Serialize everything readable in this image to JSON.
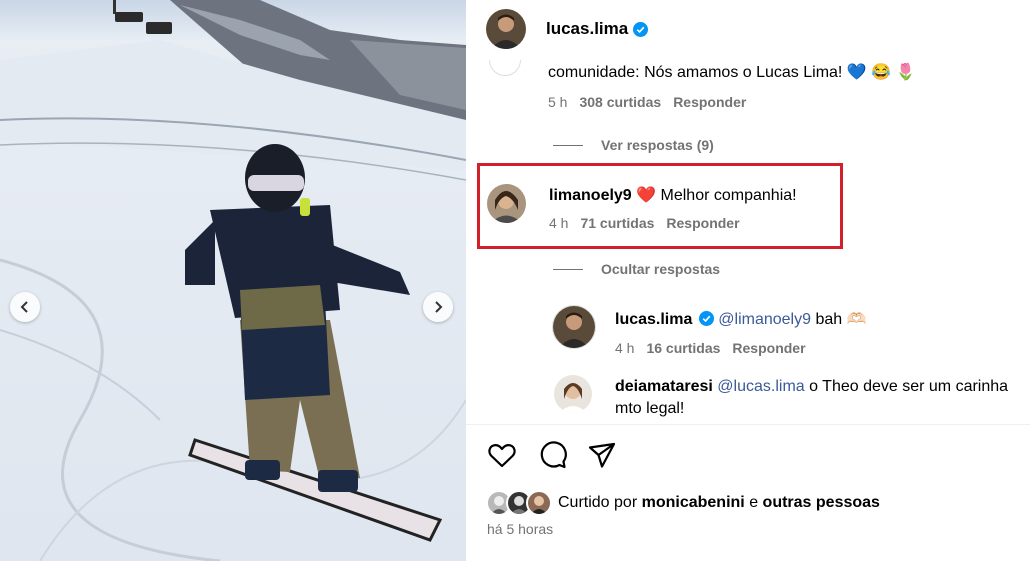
{
  "post": {
    "author": "lucas.lima"
  },
  "comments": {
    "prev_comment": {
      "text": "comunidade: Nós amamos o Lucas Lima! 💙 😂 🌷",
      "time": "5 h",
      "likes": "308 curtidas",
      "reply": "Responder"
    },
    "view_replies": "Ver respostas (9)",
    "highlighted": {
      "username": "limanoely9",
      "text": "❤️ Melhor companhia!",
      "time": "4 h",
      "likes": "71 curtidas",
      "reply": "Responder"
    },
    "hide_replies": "Ocultar respostas",
    "reply1": {
      "username": "lucas.lima",
      "mention": "@limanoely9",
      "text": "bah 🫶🏻",
      "time": "4 h",
      "likes": "16 curtidas",
      "reply": "Responder"
    },
    "reply2": {
      "username": "deiamataresi",
      "mention": "@lucas.lima",
      "text_line1": "o Theo deve ser um carinha",
      "text_line2": "mto legal!"
    }
  },
  "footer": {
    "liked_prefix": "Curtido por",
    "liked_user": "monicabenini",
    "liked_and": "e",
    "liked_others": "outras pessoas",
    "time": "há 5 horas"
  },
  "icons": {
    "like": "heart-icon",
    "comment": "comment-icon",
    "share": "send-icon",
    "verified": "verified-badge-icon"
  },
  "colors": {
    "highlight_border": "#d31f2a",
    "verified": "#0095f6",
    "muted": "#737373"
  }
}
